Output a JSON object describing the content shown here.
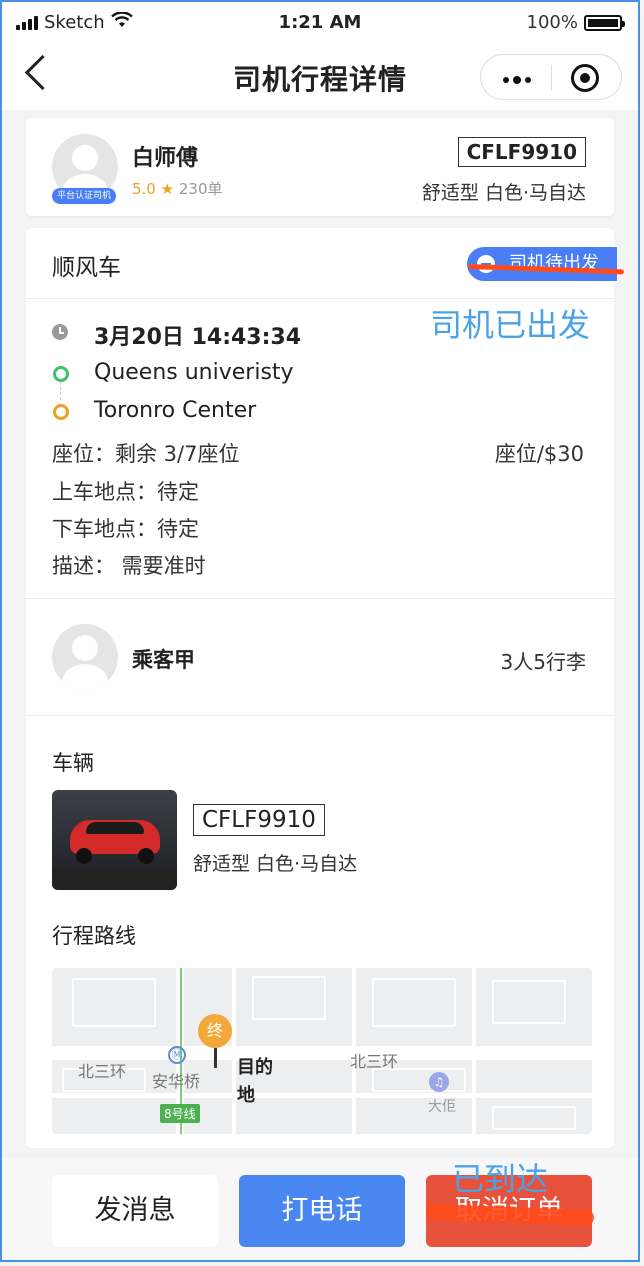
{
  "status_bar": {
    "carrier": "Sketch",
    "time": "1:21 AM",
    "battery": "100%"
  },
  "nav": {
    "title": "司机行程详情"
  },
  "driver": {
    "name": "白师傅",
    "verified_badge": "平台认证司机",
    "score": "5.0",
    "orders": "230单",
    "plate": "CFLF9910",
    "car_desc": "舒适型 白色·马自达"
  },
  "trip": {
    "type": "顺风车",
    "status": "司机待出发",
    "annotation_status": "司机已出发",
    "time": "3月20日 14:43:34",
    "from": "Queens univeristy",
    "to": "Toronro Center",
    "seats": "座位：剩余 3/7座位",
    "price": "座位/$30",
    "pickup": "上车地点：待定",
    "dropoff": "下车地点：待定",
    "description": "描述：  需要准时"
  },
  "passenger": {
    "name": "乘客甲",
    "luggage": "3人5行李"
  },
  "vehicle": {
    "section_title": "车辆",
    "plate": "CFLF9910",
    "desc": "舒适型 白色·马自达"
  },
  "route": {
    "section_title": "行程路线",
    "marker": "终",
    "destination": "目的地",
    "labels": {
      "ring_left": "北三环",
      "ring_right": "北三环",
      "bridge": "安华桥",
      "metro": "8号线",
      "poi": "大佢"
    }
  },
  "actions": {
    "message": "发消息",
    "call": "打电话",
    "cancel": "取消订单",
    "annotation_arrived": "已到达"
  },
  "colors": {
    "accent": "#4a86f0",
    "danger": "#e8523c",
    "annotation": "#4aa3e8",
    "strike": "#ff4a1a",
    "star": "#f0a020"
  }
}
